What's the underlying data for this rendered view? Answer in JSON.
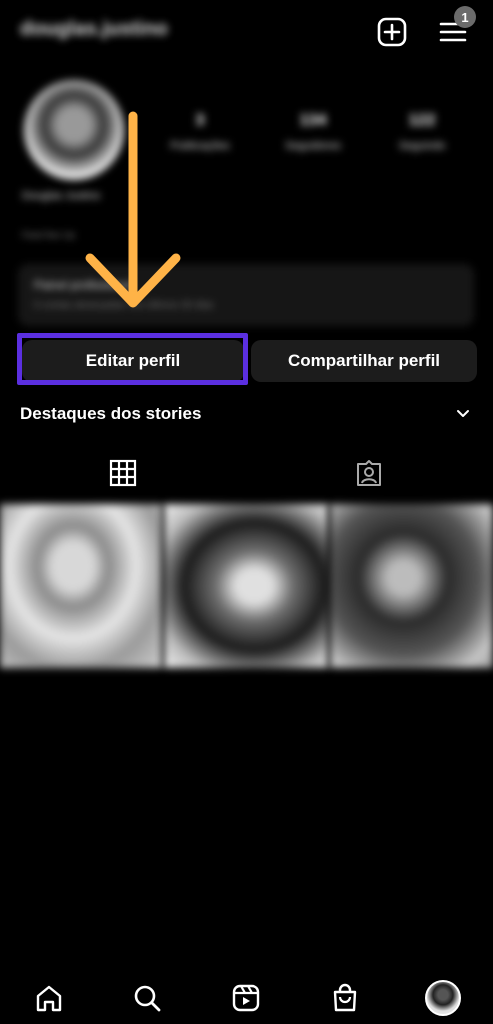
{
  "header": {
    "username": "douglas.justino",
    "notification_count": "1"
  },
  "profile": {
    "stats": [
      {
        "value": "3",
        "label": "Publicações"
      },
      {
        "value": "134",
        "label": "Seguidores"
      },
      {
        "value": "122",
        "label": "Seguindo"
      }
    ],
    "name": "Douglas Justino",
    "subtitle": "Feed Nov Up",
    "dashboard_title": "Painel profissional",
    "dashboard_subtitle": "0 contas alcançadas nos últimos 30 dias"
  },
  "actions": {
    "edit_profile": "Editar perfil",
    "share_profile": "Compartilhar perfil"
  },
  "highlights": {
    "title": "Destaques dos stories"
  },
  "colors": {
    "highlight_box": "#5b2fe0",
    "arrow": "#ffb347",
    "background": "#000000",
    "button_bg": "#1c1c1c"
  },
  "icons": {
    "new_post": "plus-square-icon",
    "menu": "hamburger-menu-icon",
    "grid_tab": "grid-icon",
    "tagged_tab": "tagged-person-icon",
    "home": "home-icon",
    "search": "search-icon",
    "reels": "reels-icon",
    "shop": "shopping-bag-icon"
  }
}
